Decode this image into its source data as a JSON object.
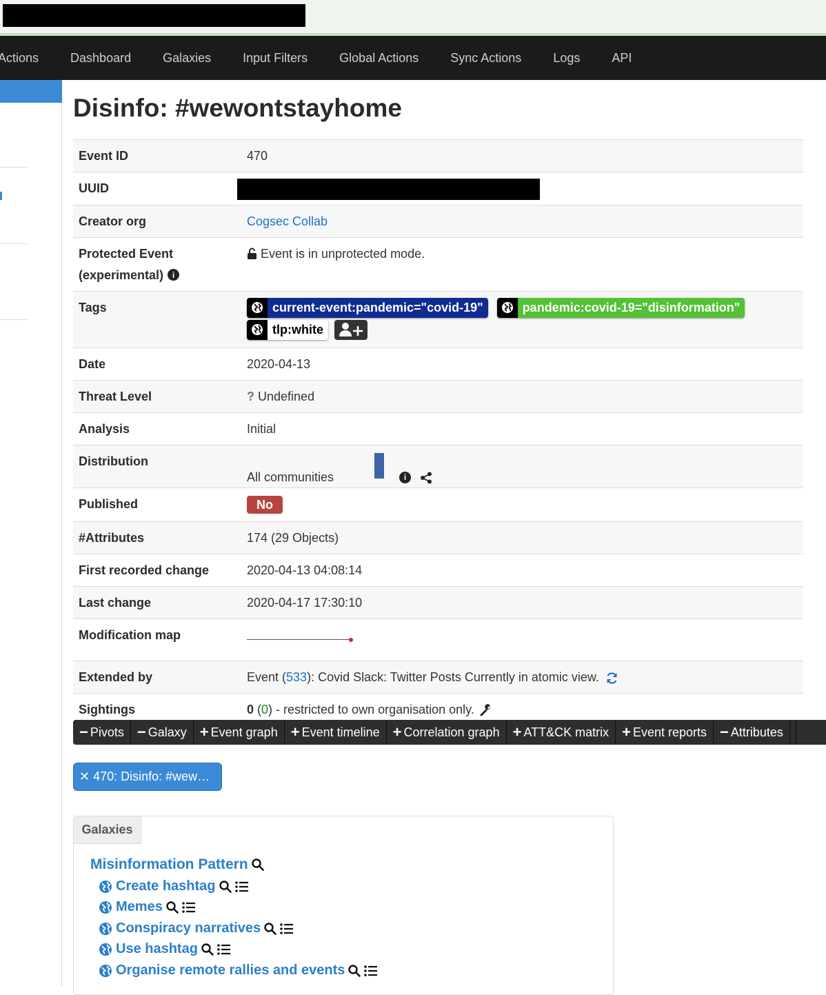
{
  "nav": {
    "items": [
      "Actions",
      "Dashboard",
      "Galaxies",
      "Input Filters",
      "Global Actions",
      "Sync Actions",
      "Logs",
      "API"
    ]
  },
  "event": {
    "title": "Disinfo: #wewontstayhome",
    "fields": {
      "event_id_label": "Event ID",
      "event_id": "470",
      "uuid_label": "UUID",
      "creator_label": "Creator org",
      "creator": "Cogsec Collab",
      "protected_label_1": "Protected Event",
      "protected_label_2": "(experimental)",
      "protected_value": "Event is in unprotected mode.",
      "tags_label": "Tags",
      "date_label": "Date",
      "date": "2020-04-13",
      "threat_label": "Threat Level",
      "threat": "Undefined",
      "analysis_label": "Analysis",
      "analysis": "Initial",
      "distribution_label": "Distribution",
      "distribution": "All communities",
      "published_label": "Published",
      "published": "No",
      "attributes_label": "#Attributes",
      "attributes": "174 (29 Objects)",
      "first_change_label": "First recorded change",
      "first_change": "2020-04-13 04:08:14",
      "last_change_label": "Last change",
      "last_change": "2020-04-17 17:30:10",
      "modmap_label": "Modification map",
      "extended_label": "Extended by",
      "extended_prefix": "Event (",
      "extended_id": "533",
      "extended_suffix": "): Covid Slack: Twitter Posts Currently in atomic view.",
      "sightings_label": "Sightings",
      "sightings_count": "0",
      "sightings_open": " (",
      "sightings_own": "0",
      "sightings_rest": ") - restricted to own organisation only."
    },
    "tags": [
      {
        "label": "current-event:pandemic=\"covid-19\"",
        "color": "#0f2c91"
      },
      {
        "label": "pandemic:covid-19=\"disinformation\"",
        "color": "#53c136"
      },
      {
        "label": "tlp:white",
        "color": "#ffffff"
      }
    ]
  },
  "toolbar": {
    "buttons": [
      {
        "sym": "−",
        "label": "Pivots"
      },
      {
        "sym": "−",
        "label": "Galaxy"
      },
      {
        "sym": "+",
        "label": "Event graph"
      },
      {
        "sym": "+",
        "label": "Event timeline"
      },
      {
        "sym": "+",
        "label": "Correlation graph"
      },
      {
        "sym": "+",
        "label": "ATT&CK matrix"
      },
      {
        "sym": "+",
        "label": "Event reports"
      },
      {
        "sym": "−",
        "label": "Attributes"
      }
    ]
  },
  "pivot_pill": "✕ 470: Disinfo: #wew…",
  "galaxies": {
    "tab": "Galaxies",
    "title": "Misinformation Pattern",
    "clusters": [
      "Create hashtag",
      "Memes",
      "Conspiracy narratives",
      "Use hashtag",
      "Organise remote rallies and events"
    ]
  }
}
